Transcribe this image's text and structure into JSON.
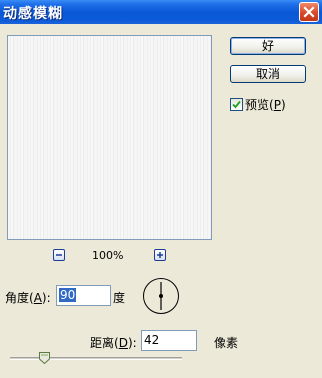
{
  "window": {
    "title": "动感模糊"
  },
  "zoom": {
    "level": "100%"
  },
  "buttons": {
    "ok": "好",
    "cancel": "取消"
  },
  "preview_option": {
    "label": "预览",
    "shortcut": "P",
    "checked": true
  },
  "angle": {
    "label": "角度",
    "shortcut": "A",
    "value": "90",
    "unit": "度"
  },
  "distance": {
    "label": "距离",
    "shortcut": "D",
    "value": "42",
    "unit": "像素",
    "slider_fraction": 0.2
  }
}
